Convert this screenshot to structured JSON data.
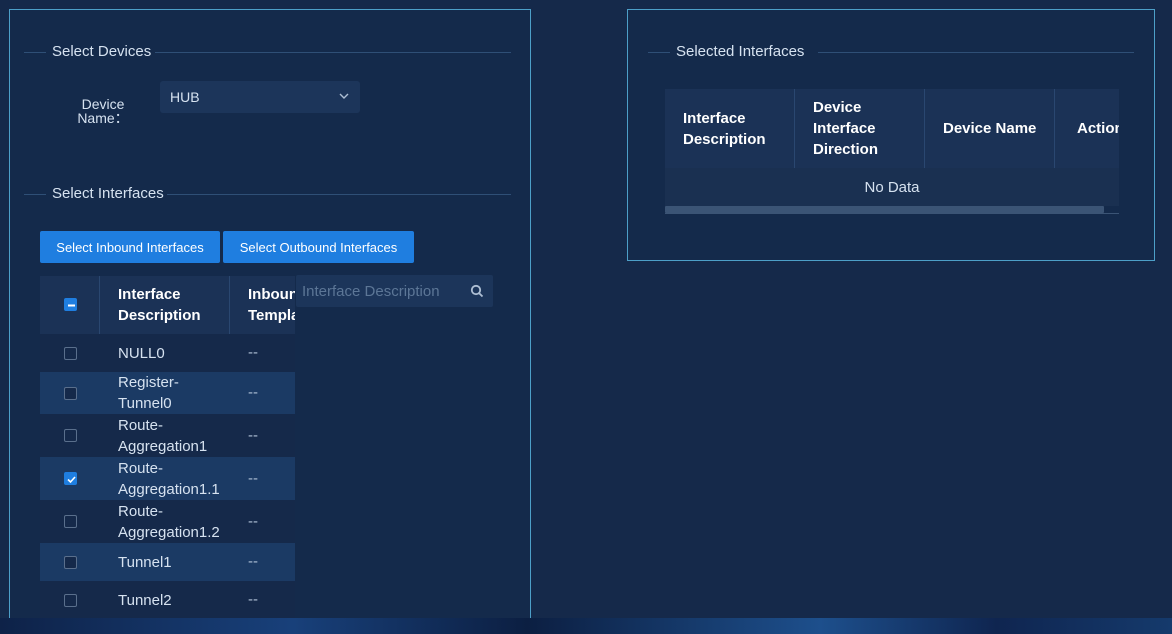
{
  "left_panel": {
    "select_devices_legend": "Select Devices",
    "device_name_label": "Device Name：",
    "device_select_value": "HUB",
    "select_interfaces_legend": "Select Interfaces",
    "btn_inbound": "Select Inbound Interfaces",
    "btn_outbound": "Select Outbound Interfaces",
    "search_placeholder": "Interface Description",
    "table": {
      "col_desc": "Interface Description",
      "col_template": "Inbound Template",
      "rows": [
        {
          "desc": "NULL0",
          "template": "--",
          "checked": false
        },
        {
          "desc": "Register-Tunnel0",
          "template": "--",
          "checked": false
        },
        {
          "desc": "Route-Aggregation1",
          "template": "--",
          "checked": false
        },
        {
          "desc": "Route-Aggregation1.1",
          "template": "--",
          "checked": true
        },
        {
          "desc": "Route-Aggregation1.2",
          "template": "--",
          "checked": false
        },
        {
          "desc": "Tunnel1",
          "template": "--",
          "checked": false
        },
        {
          "desc": "Tunnel2",
          "template": "--",
          "checked": false
        }
      ]
    }
  },
  "right_panel": {
    "legend": "Selected Interfaces",
    "table": {
      "col_desc": "Interface Description",
      "col_direction": "Device Interface Direction",
      "col_device": "Device Name",
      "col_action": "Action",
      "empty_text": "No Data"
    }
  },
  "icons": {
    "select_arrow": "chevron-down-icon",
    "search": "search-icon",
    "checkbox_check": "check-icon"
  },
  "colors": {
    "accent": "#1f7ee0",
    "panel_border": "#4d9fc8",
    "background": "#15294a"
  }
}
